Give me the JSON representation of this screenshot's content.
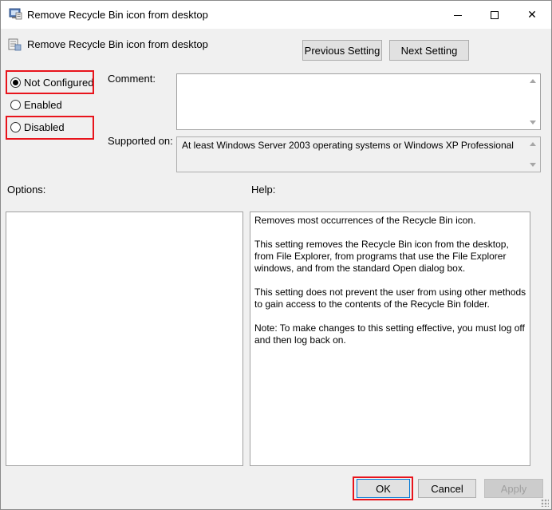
{
  "window": {
    "title": "Remove Recycle Bin icon from desktop",
    "controls": {
      "minimize": "minimize",
      "maximize": "maximize",
      "close": "✕"
    }
  },
  "header": {
    "policy_title": "Remove Recycle Bin icon from desktop",
    "previous_setting": "Previous Setting",
    "next_setting": "Next Setting"
  },
  "state": {
    "options": [
      {
        "label": "Not Configured",
        "checked": true,
        "highlighted": true
      },
      {
        "label": "Enabled",
        "checked": false,
        "highlighted": false
      },
      {
        "label": "Disabled",
        "checked": false,
        "highlighted": true
      }
    ]
  },
  "fields": {
    "comment_label": "Comment:",
    "comment_value": "",
    "supported_label": "Supported on:",
    "supported_value": "At least Windows Server 2003 operating systems or Windows XP Professional"
  },
  "panels": {
    "options_label": "Options:",
    "help_label": "Help:",
    "help_paragraphs": [
      "Removes most occurrences of the Recycle Bin icon.",
      "This setting removes the Recycle Bin icon from the desktop, from File Explorer, from programs that use the File Explorer windows, and from the standard Open dialog box.",
      "This setting does not prevent the user from using other methods to gain access to the contents of the Recycle Bin folder.",
      "Note: To make changes to this setting effective, you must log off and then log back on."
    ]
  },
  "footer": {
    "ok": "OK",
    "cancel": "Cancel",
    "apply": "Apply"
  },
  "colors": {
    "highlight": "#e8141c",
    "window_bg": "#f0f0f0",
    "ok_border": "#0078d7"
  },
  "icons": {
    "title_icon": "policy-settings-icon",
    "header_icon": "policy-settings-icon"
  }
}
